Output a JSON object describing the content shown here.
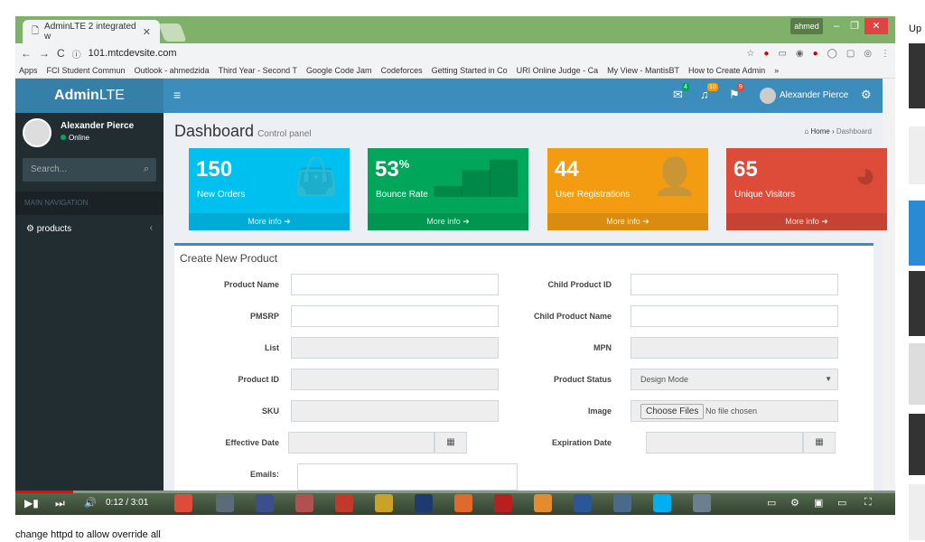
{
  "browser": {
    "tab_title": "AdminLTE 2 integrated w",
    "profile": "ahmed",
    "url": "101.mtcdevsite.com",
    "bookmarks": [
      "Apps",
      "FCI Student Commun",
      "Outlook - ahmedzida",
      "Third Year - Second T",
      "Google Code Jam",
      "Codeforces",
      "Getting Started in Co",
      "URI Online Judge - Ca",
      "My View - MantisBT",
      "How to Create Admin",
      "»"
    ]
  },
  "admin": {
    "logo_a": "Admin",
    "logo_b": "LTE",
    "user": "Alexander Pierce",
    "status": "Online",
    "search_placeholder": "Search...",
    "nav_header": "MAIN NAVIGATION",
    "nav_item": "products",
    "badges": {
      "mail": "4",
      "bell": "10",
      "flag": "9"
    },
    "page_title": "Dashboard",
    "page_subtitle": "Control panel",
    "crumb_home": "Home",
    "crumb_current": "Dashboard",
    "boxes": [
      {
        "value": "150",
        "suffix": "",
        "label": "New Orders",
        "more": "More info",
        "color": "#00c0ef"
      },
      {
        "value": "53",
        "suffix": "%",
        "label": "Bounce Rate",
        "more": "More info",
        "color": "#00a65a"
      },
      {
        "value": "44",
        "suffix": "",
        "label": "User Registrations",
        "more": "More info",
        "color": "#f39c12"
      },
      {
        "value": "65",
        "suffix": "",
        "label": "Unique Visitors",
        "more": "More info",
        "color": "#dd4b39"
      }
    ],
    "form": {
      "title": "Create New Product",
      "left": [
        {
          "label": "Product Name"
        },
        {
          "label": "PMSRP"
        },
        {
          "label": "List"
        },
        {
          "label": "Product ID"
        },
        {
          "label": "SKU"
        },
        {
          "label": "Effective Date"
        },
        {
          "label": "Emails:"
        }
      ],
      "right": [
        {
          "label": "Child Product ID"
        },
        {
          "label": "Child Product Name"
        },
        {
          "label": "MPN"
        },
        {
          "label": "Product Status",
          "value": "Design Mode"
        },
        {
          "label": "Image",
          "button": "Choose Files",
          "value": "No file chosen"
        },
        {
          "label": "Expiration Date"
        }
      ]
    }
  },
  "video": {
    "time": "0:12 / 3:01",
    "progress": 0.066,
    "caption": "change httpd to allow override all"
  },
  "sidebar": {
    "label": "Up"
  }
}
